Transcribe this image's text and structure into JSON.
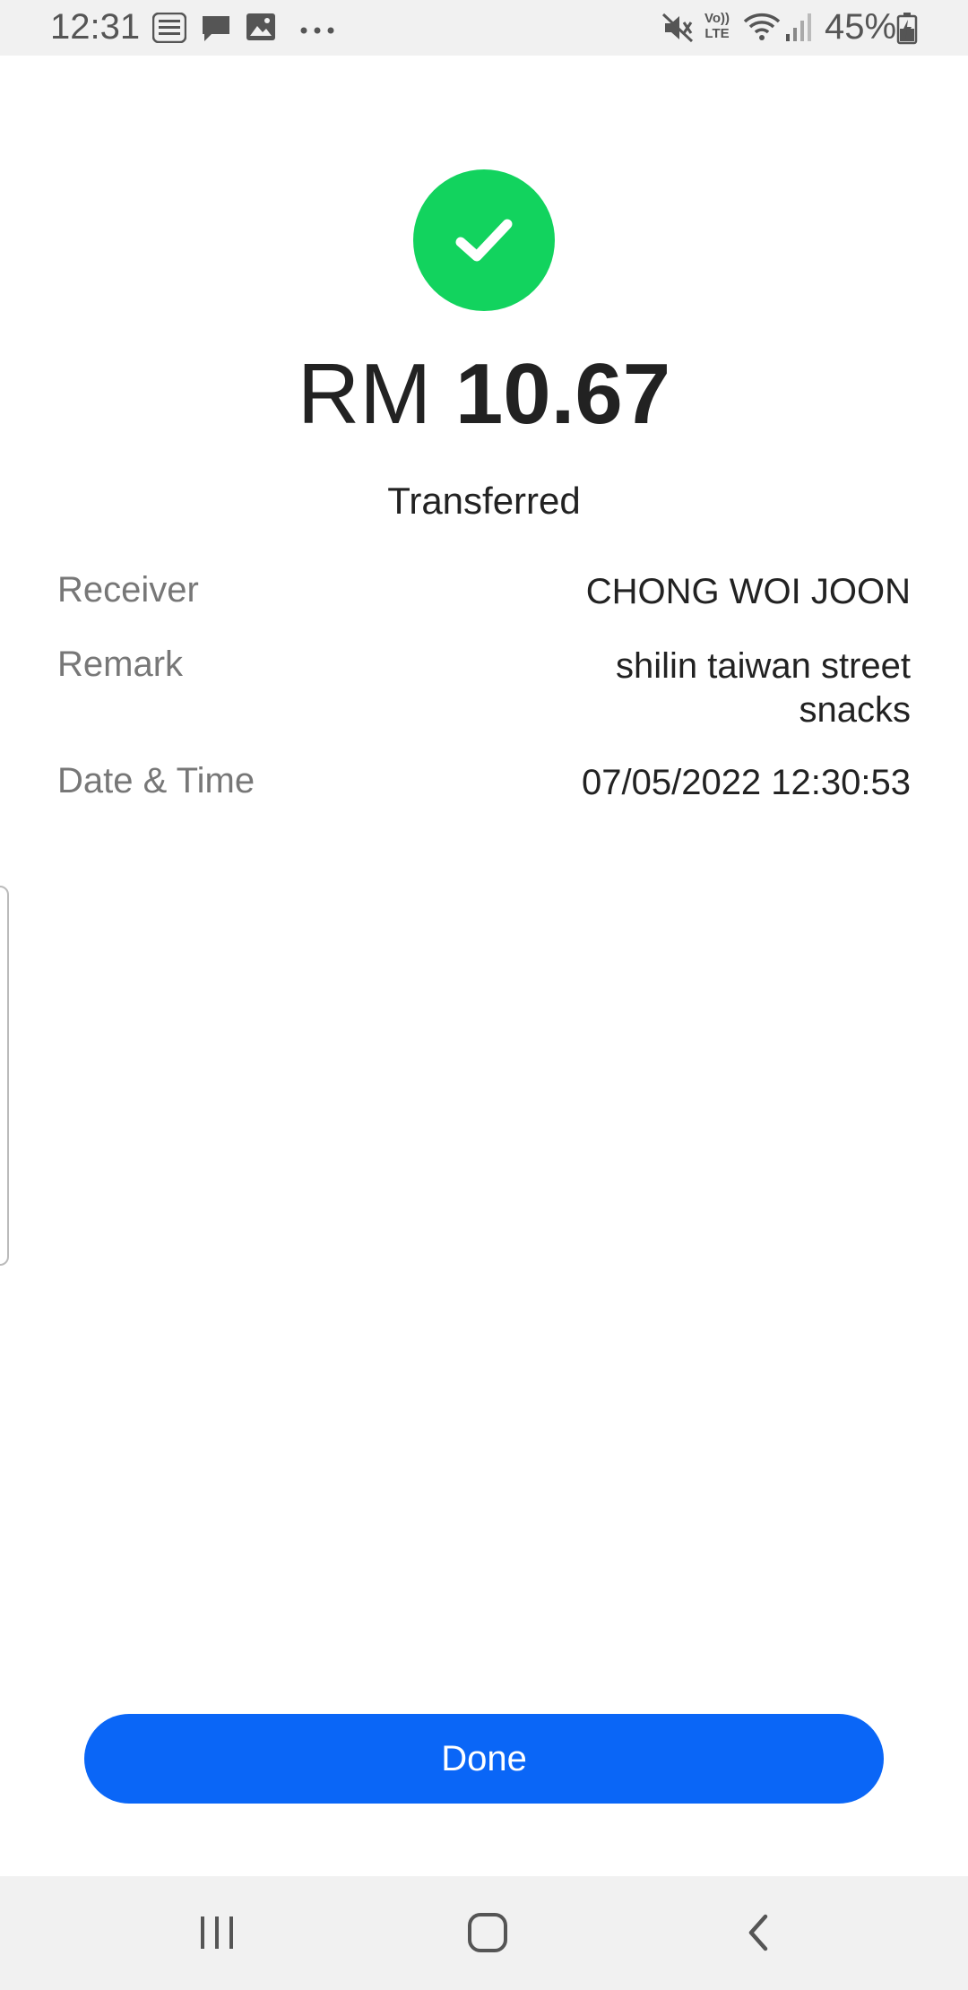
{
  "status_bar": {
    "time": "12:31",
    "battery_percent": "45%",
    "left_icons": [
      "tng-ewallet-icon",
      "message-icon",
      "image-icon",
      "more-icon"
    ],
    "right_icons": [
      "mute-icon",
      "volte-icon",
      "wifi-icon",
      "signal-icon",
      "battery-icon"
    ],
    "volte_line1": "Vo))",
    "volte_line2": "LTE"
  },
  "receipt": {
    "currency": "RM",
    "amount": "10.67",
    "status": "Transferred",
    "success_color": "#12d35e",
    "details": [
      {
        "label": "Receiver",
        "value": "CHONG WOI JOON"
      },
      {
        "label": "Remark",
        "value": "shilin taiwan street snacks"
      },
      {
        "label": "Date & Time",
        "value": "07/05/2022 12:30:53"
      }
    ]
  },
  "actions": {
    "done_label": "Done",
    "accent_color": "#0a66f7"
  },
  "nav_bar": {
    "icons": [
      "recent-apps-icon",
      "home-icon",
      "back-icon"
    ]
  }
}
